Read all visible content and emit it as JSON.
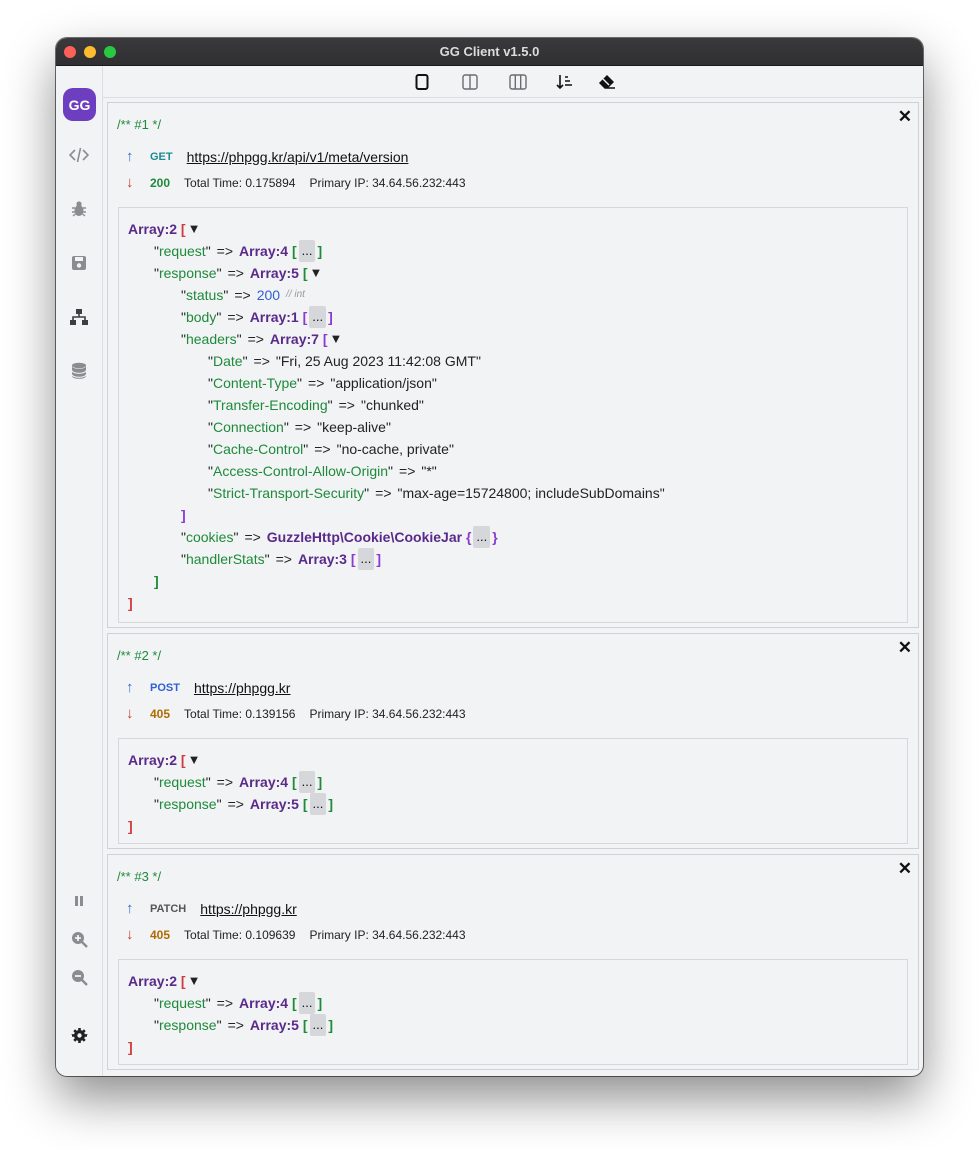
{
  "window": {
    "title": "GG Client v1.5.0"
  },
  "sidebar": {
    "logo": "GG"
  },
  "entries": [
    {
      "comment": "/** #1 */",
      "method": "GET",
      "url": "https://phpgg.kr/api/v1/meta/version",
      "status": "200",
      "total_time": "Total Time: 0.175894",
      "primary_ip": "Primary IP: 34.64.56.232:443",
      "dump": {
        "root_type": "Array:2",
        "request_key": "\"request\"",
        "request_type": "Array:4",
        "response_key": "\"response\"",
        "response_type": "Array:5",
        "status_key": "\"status\"",
        "status_val": "200",
        "status_hint": "// int",
        "body_key": "\"body\"",
        "body_type": "Array:1",
        "headers_key": "\"headers\"",
        "headers_type": "Array:7",
        "headers": [
          {
            "k": "\"Date\"",
            "v": "\"Fri, 25 Aug 2023 11:42:08 GMT\""
          },
          {
            "k": "\"Content-Type\"",
            "v": "\"application/json\""
          },
          {
            "k": "\"Transfer-Encoding\"",
            "v": "\"chunked\""
          },
          {
            "k": "\"Connection\"",
            "v": "\"keep-alive\""
          },
          {
            "k": "\"Cache-Control\"",
            "v": "\"no-cache, private\""
          },
          {
            "k": "\"Access-Control-Allow-Origin\"",
            "v": "\"*\""
          },
          {
            "k": "\"Strict-Transport-Security\"",
            "v": "\"max-age=15724800; includeSubDomains\""
          }
        ],
        "cookies_key": "\"cookies\"",
        "cookies_type": "GuzzleHttp\\Cookie\\CookieJar",
        "handler_key": "\"handlerStats\"",
        "handler_type": "Array:3"
      }
    },
    {
      "comment": "/** #2 */",
      "method": "POST",
      "url": "https://phpgg.kr",
      "status": "405",
      "total_time": "Total Time: 0.139156",
      "primary_ip": "Primary IP: 34.64.56.232:443",
      "dump": {
        "root_type": "Array:2",
        "request_key": "\"request\"",
        "request_type": "Array:4",
        "response_key": "\"response\"",
        "response_type": "Array:5"
      }
    },
    {
      "comment": "/** #3 */",
      "method": "PATCH",
      "url": "https://phpgg.kr",
      "status": "405",
      "total_time": "Total Time: 0.109639",
      "primary_ip": "Primary IP: 34.64.56.232:443",
      "dump": {
        "root_type": "Array:2",
        "request_key": "\"request\"",
        "request_type": "Array:4",
        "response_key": "\"response\"",
        "response_type": "Array:5"
      }
    }
  ],
  "symbols": {
    "arrow": "=>",
    "dots": "...",
    "toggle": "▼",
    "open_sq": "[",
    "close_sq": "]",
    "open_cu": "{",
    "close_cu": "}",
    "close_x": "✕",
    "up": "↑",
    "down": "↓"
  },
  "colors": {
    "accent": "#6d3fc0",
    "key": "#1e8a3a",
    "type": "#5a2a8a",
    "bracket_root": "#d13a3a"
  }
}
